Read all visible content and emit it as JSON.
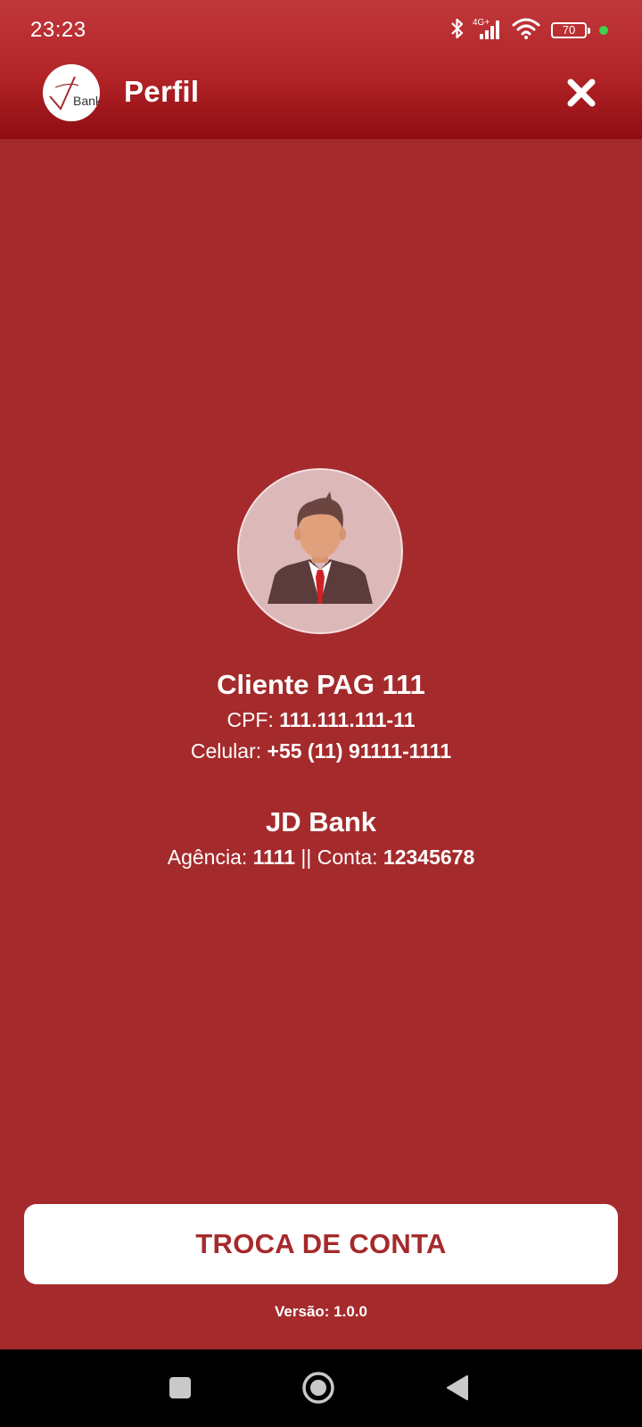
{
  "status_bar": {
    "time": "23:23",
    "network_label": "4G+",
    "battery_level": "70",
    "icons": [
      "bluetooth-icon",
      "signal-icon",
      "wifi-icon",
      "battery-icon",
      "notification-dot"
    ]
  },
  "header": {
    "logo_text": "Bank",
    "title": "Perfil",
    "close_icon": "close-icon"
  },
  "profile": {
    "avatar_icon": "user-avatar",
    "name": "Cliente PAG 111",
    "cpf_label": "CPF:",
    "cpf_value": "111.111.111-11",
    "phone_label": "Celular:",
    "phone_value": "+55 (11) 91111-1111"
  },
  "bank": {
    "name": "JD Bank",
    "agency_label": "Agência:",
    "agency_value": "1111",
    "separator": "||",
    "account_label": "Conta:",
    "account_value": "12345678"
  },
  "actions": {
    "switch_account_label": "TROCA DE CONTA"
  },
  "footer": {
    "version_text": "Versão: 1.0.0"
  },
  "nav_bar": {
    "buttons": [
      "recents-button",
      "home-button",
      "back-button"
    ]
  },
  "colors": {
    "background": "#a52a2c",
    "header_top": "#c0373a",
    "header_bottom": "#8e0c10",
    "button_background": "#ffffff",
    "button_text": "#a52a2c",
    "avatar_background": "#dcb8b9"
  }
}
